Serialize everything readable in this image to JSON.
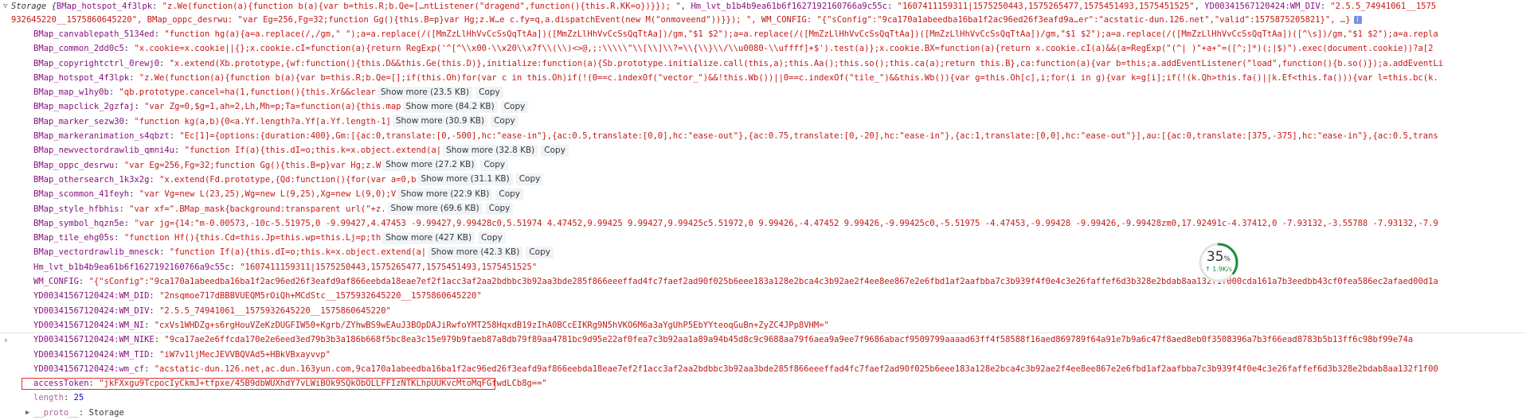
{
  "header": {
    "prefix": "Storage {",
    "key1": "BMap_hotspot_4f3lpk",
    "val1": "\"z.We(function(a){function b(a){var b=this.R;b.Qe=[…ntListener(\"dragend\",function(){this.R.KK=o})}}); \"",
    "key2": "Hm_lvt_b1b4b9ea61b6f1627192160766a9c55c",
    "val2": "\"1607411159311|1575250443,1575265477,1575451493,1575451525\"",
    "key3": "YD00341567120424:WM_DIV",
    "val3": "\"2.5.5_74941061__1575",
    "line2": "932645220__1575860645220\", BMap_oppc_desrwu: \"var Eg=256,Fg=32;function Gg(){this.B=p}var Hg;z.W…e c.fy=q,a.dispatchEvent(new M(\"onmoveend\"))}}); \", WM_CONFIG: \"{\"sConfig\":\"9ca170a1abeedba16ba1f2ac96ed26f3eafd9a…er\":\"acstatic-dun.126.net\",\"valid\":1575875205821}\", …}",
    "info_label": "i"
  },
  "rows": [
    {
      "key": "BMap_canvablepath_5134ed",
      "value": "\"function hg(a){a=a.replace(/,/gm,\" \");a=a.replace(/([MmZzLlHhVvCcSsQqTtAa])([MmZzLlHhVvCcSsQqTtAa])/gm,\"$1 $2\");a=a.replace(/([MmZzLlHhVvCcSsQqTtAa])([MmZzLlHhVvCcSsQqTtAa])/gm,\"$1 $2\");a=a.replace(/([MmZzLlHhVvCcSsQqTtAa])([^\\s])/gm,\"$1 $2\");a=a.repla",
      "show_more": "",
      "copy": ""
    },
    {
      "key": "BMap_common_2dd0c5",
      "value": "\"x.cookie=x.cookie||{};x.cookie.cI=function(a){return RegExp('^[^\\\\x00-\\\\x20\\\\x7f\\\\(\\\\)<>@,;:\\\\\\\\\\\"\\\\[\\\\]\\\\?=\\\\{\\\\}\\\\/\\\\u0080-\\\\uffff]+$').test(a)};x.cookie.BX=function(a){return x.cookie.cI(a)&&(a=RegExp(\"(^| )\"+a+\"=([^;]*)(;|$)\").exec(document.cookie))?a[2",
      "show_more": "",
      "copy": ""
    },
    {
      "key": "BMap_copyrightctrl_0rewj0",
      "value": "\"x.extend(Xb.prototype,{wf:function(){this.D&&this.Ge(this.D)},initialize:function(a){Sb.prototype.initialize.call(this,a);this.Aa();this.so();this.ca(a);return this.B},ca:function(a){var b=this;a.addEventListener(\"load\",function(){b.so()});a.addEventLi",
      "show_more": "",
      "copy": ""
    },
    {
      "key": "BMap_hotspot_4f3lpk",
      "value": "\"z.We(function(a){function b(a){var b=this.R;b.Qe=[];if(this.Oh)for(var c in this.Oh)if(!(0==c.indexOf(\"vector_\")&&!this.Wb())||0==c.indexOf(\"tile_\")&&this.Wb()){var g=this.Oh[c],i;for(i in g){var k=g[i];if(!(k.Qh>this.fa()||k.Ef<this.fa())){var l=this.bc(k.",
      "show_more": "",
      "copy": ""
    },
    {
      "key": "BMap_map_w1hy0b",
      "value": "\"qb.prototype.cancel=ha(1,function(){this.Xr&&clear",
      "show_more": "Show more (23.5 KB)",
      "copy": "Copy"
    },
    {
      "key": "BMap_mapclick_2gzfaj",
      "value": "\"var Zg=0,$g=1,ah=2,Lh,Mh=p;Ta=function(a){this.map",
      "show_more": "Show more (84.2 KB)",
      "copy": "Copy"
    },
    {
      "key": "BMap_marker_sezw30",
      "value": "\"function kg(a,b){0<a.Yf.length?a.Yf[a.Yf.length-1]",
      "show_more": "Show more (30.9 KB)",
      "copy": "Copy"
    },
    {
      "key": "BMap_markeranimation_s4qbzt",
      "value": "\"Ec[1]={options:{duration:400},Gm:[{ac:0,translate:[0,-500],hc:\"ease-in\"},{ac:0.5,translate:[0,0],hc:\"ease-out\"},{ac:0.75,translate:[0,-20],hc:\"ease-in\"},{ac:1,translate:[0,0],hc:\"ease-out\"}],au:[{ac:0,translate:[375,-375],hc:\"ease-in\"},{ac:0.5,trans",
      "show_more": "",
      "copy": ""
    },
    {
      "key": "BMap_newvectordrawlib_qmni4u",
      "value": "\"function If(a){this.dI=o;this.k=x.object.extend(a|",
      "show_more": "Show more (32.8 KB)",
      "copy": "Copy"
    },
    {
      "key": "BMap_oppc_desrwu",
      "value": "\"var Eg=256,Fg=32;function Gg(){this.B=p}var Hg;z.W",
      "show_more": "Show more (27.2 KB)",
      "copy": "Copy"
    },
    {
      "key": "BMap_othersearch_1k3x2g",
      "value": "\"x.extend(Fd.prototype,{Qd:function(){for(var a=0,b",
      "show_more": "Show more (31.1 KB)",
      "copy": "Copy"
    },
    {
      "key": "BMap_scommon_41feyh",
      "value": "\"var Vg=new L(23,25),Wg=new L(9,25),Xg=new L(9,0);V",
      "show_more": "Show more (22.9 KB)",
      "copy": "Copy"
    },
    {
      "key": "BMap_style_hfbhis",
      "value": "\"var xf=\".BMap_mask{background:transparent url(\"+z.",
      "show_more": "Show more (69.6 KB)",
      "copy": "Copy"
    },
    {
      "key": "BMap_symbol_hqzn5e",
      "value": "\"var jg={14:\"m-0.00573,-10c-5.51975,0 -9.99427,4.47453 -9.99427,9.99428c0,5.51974 4.47452,9.99425 9.99427,9.99425c5.51972,0 9.99426,-4.47452 9.99426,-9.99425c0,-5.51975 -4.47453,-9.99428 -9.99426,-9.99428zm0,17.92491c-4.37412,0 -7.93132,-3.55788 -7.93132,-7.9",
      "show_more": "",
      "copy": ""
    },
    {
      "key": "BMap_tile_ehg05s",
      "value": "\"function Hf(){this.Cd=this.Jp=this.wp=this.Lj=p;th",
      "show_more": "Show more (427 KB)",
      "copy": "Copy"
    },
    {
      "key": "BMap_vectordrawlib_mnesck",
      "value": "\"function If(a){this.dI=o;this.k=x.object.extend(a|",
      "show_more": "Show more (42.3 KB)",
      "copy": "Copy"
    },
    {
      "key": "Hm_lvt_b1b4b9ea61b6f1627192160766a9c55c",
      "value": "\"1607411159311|1575250443,1575265477,1575451493,1575451525\"",
      "show_more": "",
      "copy": ""
    },
    {
      "key": "WM_CONFIG",
      "value": "\"{\"sConfig\":\"9ca170a1abeedba16ba1f2ac96ed26f3eafd9af866eebda18eae7ef2f1acc3af2aa2bdbbc3b92aa3bde285f866eeeffad4fc7faef2ad90f025b6eee183a128e2bca4c3b92ae2f4ee8ee867e2e6fbd1af2aafbba7c3b939f4f0e4c3e26faffef6d3b328e2bdab8aa132f1f000cda161a7b3eedbb43cf0fea586ec2afaed00d1a",
      "show_more": "",
      "copy": ""
    },
    {
      "key": "YD00341567120424:WM_DID",
      "value": "\"2nsqmoe717dBBBVUEQM5rOiQh+MCdStc__1575932645220__1575860645220\"",
      "show_more": "",
      "copy": ""
    },
    {
      "key": "YD00341567120424:WM_DIV",
      "value": "\"2.5.5_74941061__1575932645220__1575860645220\"",
      "show_more": "",
      "copy": ""
    },
    {
      "key": "YD00341567120424:WM_NI",
      "value": "\"cxVs1WHDZg+s6rgHouVZeKzDUGFIW50+Kgrb/ZYhwBS9wEAuJ3BOpDAJiRwfoYMT258HqxdB19zIhA0BCcEIKRg9N5hVKO6M6a3aYgUhP5EbYYteoqGuBn+ZyZC4JPp8VHM=\"",
      "show_more": "",
      "copy": ""
    },
    {
      "key": "YD00341567120424:WM_NIKE",
      "value": "\"9ca17ae2e6ffcda170e2e6eed3ed79b3b3a186b668f5bc8ea3c15e979b9faeb87a8db79f89aa4781bc9d95e22af0fea7c3b92aa1a89a94b45d8c9c9688aa79f6aea9a9ee7f9686abacf9509799aaaad63ff4f58588f16aed869789f64a91e7b9a6c47f8aed8eb0f3508396a7b3f66ead8783b5b13ff6c98bf99e74a",
      "show_more": "",
      "copy": ""
    },
    {
      "key": "YD00341567120424:WM_TID",
      "value": "\"iW7v1ljMecJEVVBQVAd5+HBkVBxayvvp\"",
      "show_more": "",
      "copy": ""
    },
    {
      "key": "YD00341567120424:wm_cf",
      "value": "\"acstatic-dun.126.net,ac.dun.163yun.com,9ca170a1abeedba16ba1f2ac96ed26f3eafd9af866eebda18eae7ef2f1acc3af2aa2bdbbc3b92aa3bde285f866eeeffad4fc7faef2ad90f025b6eee183a128e2bca4c3b92ae2f4ee8ee867e2e6fbd1af2aafbba7c3b939f4f0e4c3e26faffef6d3b328e2bdab8aa132f1f00",
      "show_more": "",
      "copy": ""
    },
    {
      "key": "accessToken",
      "value": "\"jkFXxgu9TcpocIyCkmJ+tfpxe/45B9dbWUXhdY7vLWiBOk9SQkObOLLFFIzNTKLhpUUKvcMtoMqFGfwdLCb8g==\"",
      "show_more": "",
      "copy": ""
    }
  ],
  "length_key": "length",
  "length_value": "25",
  "proto_key": "__proto__",
  "proto_value": "Storage",
  "prompt": "›",
  "meter": {
    "percent": "35",
    "unit": "%",
    "speed": "↑ 1.9K/s",
    "fill_fraction": 0.35,
    "ring_color": "#1e8e3e"
  }
}
